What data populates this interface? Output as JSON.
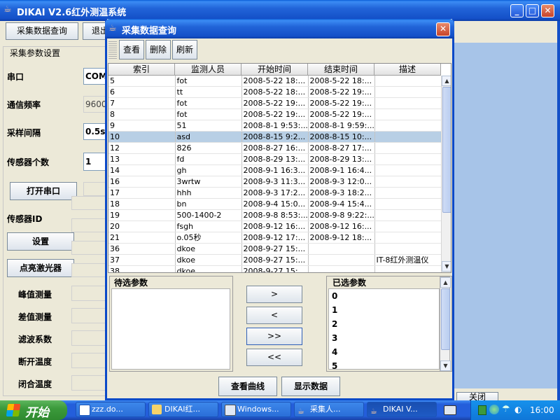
{
  "main_window": {
    "title": "DIKAI V2.6红外测温系统",
    "menu": [
      "采集数据查询",
      "退出"
    ],
    "settings_title": "采集参数设置",
    "labels": {
      "port": "串口",
      "baud": "通信频率",
      "interval": "采样间隔",
      "sensor_count": "传感器个数",
      "sensor_id": "传感器ID",
      "peak": "峰值测量",
      "diff": "差值测量",
      "filter": "滤波系数",
      "off_temp": "断开温度",
      "on_temp": "闭合温度"
    },
    "values": {
      "port": "COM",
      "baud": "9600",
      "interval": "0.5s",
      "sensor_count": "1"
    },
    "buttons": {
      "open_port": "打开串口",
      "set": "设置",
      "laser": "点亮激光器",
      "close": "关闭"
    }
  },
  "dialog": {
    "title": "采集数据查询",
    "toolbar": [
      "查看",
      "删除",
      "刷新"
    ],
    "columns": [
      "索引",
      "监测人员",
      "开始时间",
      "结束时间",
      "描述"
    ],
    "selected_index": 5,
    "rows": [
      [
        "5",
        "fot",
        "2008-5-22 18:...",
        "2008-5-22 18:...",
        ""
      ],
      [
        "6",
        "tt",
        "2008-5-22 18:...",
        "2008-5-22 19:...",
        ""
      ],
      [
        "7",
        "fot",
        "2008-5-22 19:...",
        "2008-5-22 19:...",
        ""
      ],
      [
        "8",
        "fot",
        "2008-5-22 19:...",
        "2008-5-22 19:...",
        ""
      ],
      [
        "9",
        "51",
        "2008-8-1 9:53:...",
        "2008-8-1 9:59:...",
        ""
      ],
      [
        "10",
        "asd",
        "2008-8-15 9:2...",
        "2008-8-15 10:...",
        ""
      ],
      [
        "12",
        "826",
        "2008-8-27 16:...",
        "2008-8-27 17:...",
        ""
      ],
      [
        "13",
        "fd",
        "2008-8-29 13:...",
        "2008-8-29 13:...",
        ""
      ],
      [
        "14",
        "gh",
        "2008-9-1 16:3...",
        "2008-9-1 16:4...",
        ""
      ],
      [
        "16",
        "3wrtw",
        "2008-9-3 11:3...",
        "2008-9-3 12:0...",
        ""
      ],
      [
        "17",
        "hhh",
        "2008-9-3 17:2...",
        "2008-9-3 18:2...",
        ""
      ],
      [
        "18",
        "bn",
        "2008-9-4 15:0...",
        "2008-9-4 15:4...",
        ""
      ],
      [
        "19",
        "500-1400-2",
        "2008-9-8 8:53:...",
        "2008-9-8 9:22:...",
        ""
      ],
      [
        "20",
        "fsgh",
        "2008-9-12 16:...",
        "2008-9-12 16:...",
        ""
      ],
      [
        "21",
        "o.05秒",
        "2008-9-12 17:...",
        "2008-9-12 18:...",
        ""
      ],
      [
        "36",
        "dkoe",
        "2008-9-27 15:...",
        "",
        ""
      ],
      [
        "37",
        "dkoe",
        "2008-9-27 15:...",
        "",
        "IT-8红外测温仪"
      ],
      [
        "38",
        "dkoe",
        "2008-9-27 15:...",
        "",
        ""
      ]
    ],
    "pending_title": "待选参数",
    "selected_title": "已选参数",
    "selected_params": [
      "0",
      "1",
      "2",
      "3",
      "4",
      "5"
    ],
    "move_buttons": [
      ">",
      "<",
      ">>",
      "<<"
    ],
    "bottom_buttons": [
      "查看曲线",
      "显示数据"
    ]
  },
  "taskbar": {
    "start": "开始",
    "items": [
      "zzz.do...",
      "DIKAI红...",
      "Windows...",
      "采集人...",
      "DIKAI V..."
    ],
    "time": "16:00"
  },
  "colors": {
    "title_blue": "#2164d8",
    "selection": "#b8cfe5",
    "taskbar": "#2a5fd0",
    "start_green": "#3c9a3c"
  }
}
